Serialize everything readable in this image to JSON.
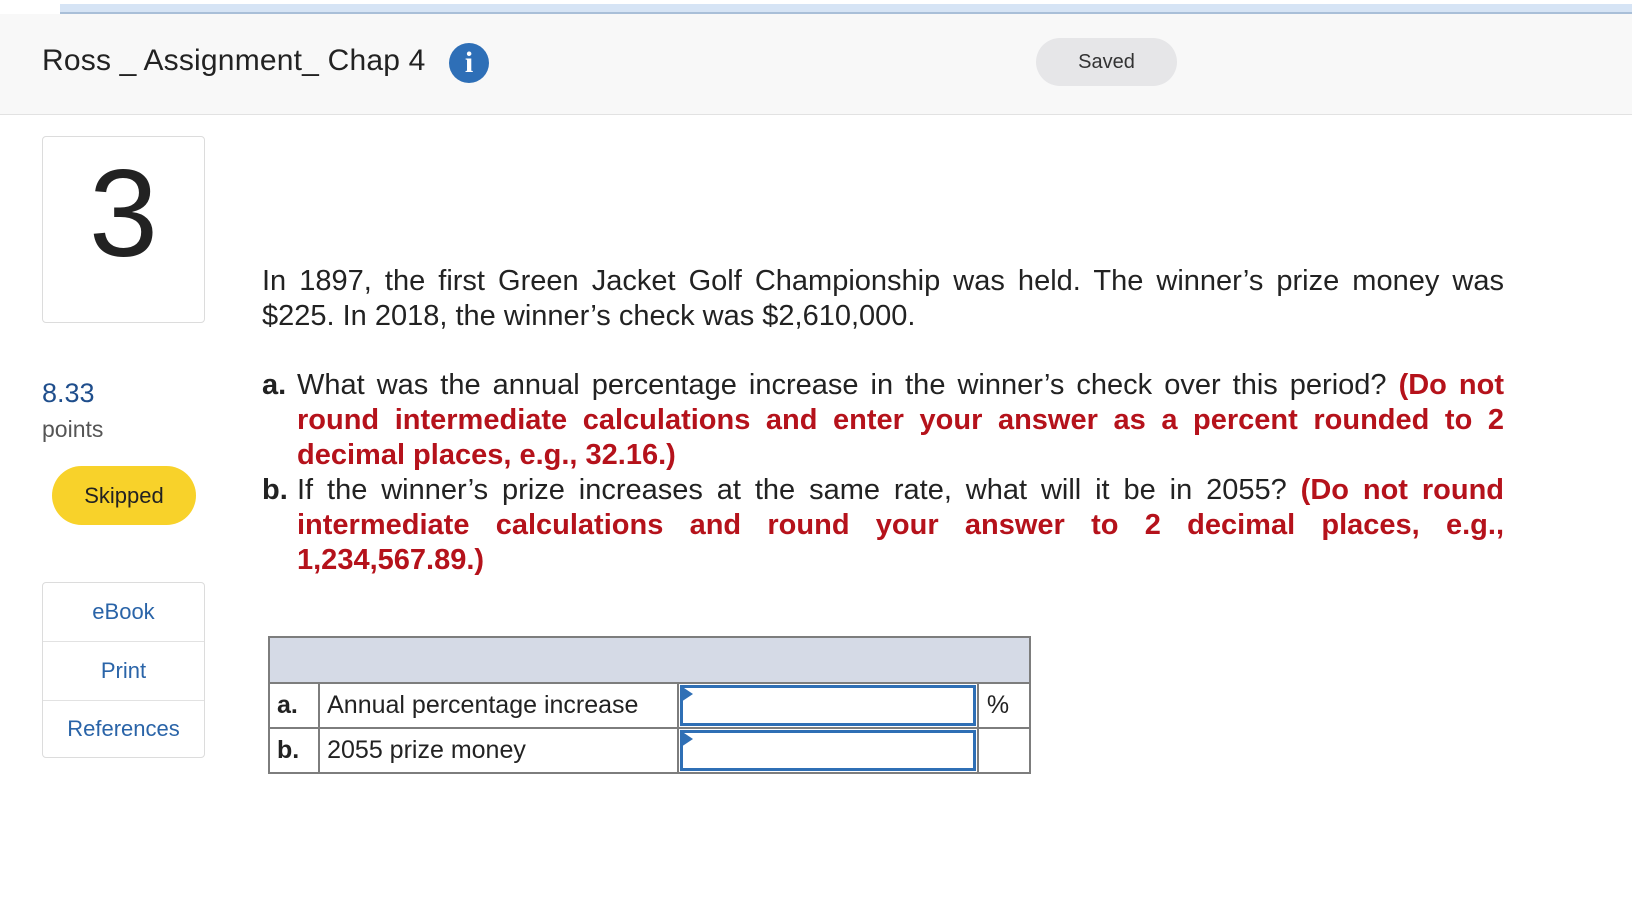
{
  "header": {
    "title": "Ross _ Assignment_ Chap 4",
    "info_icon": "i",
    "saved_label": "Saved"
  },
  "sidebar": {
    "question_number": "3",
    "points_value": "8.33",
    "points_label": "points",
    "status_badge": "Skipped",
    "resources": [
      {
        "label": "eBook"
      },
      {
        "label": "Print"
      },
      {
        "label": "References"
      }
    ]
  },
  "question": {
    "intro": "In 1897, the first Green Jacket Golf Championship was held. The winner’s prize money was $225. In 2018, the winner’s check was $2,610,000.",
    "parts": [
      {
        "letter": "a.",
        "text": "What was the annual percentage increase in the winner’s check over this period?",
        "note": "(Do not round intermediate calculations and enter your answer as a percent rounded to 2 decimal places, e.g., 32.16.)"
      },
      {
        "letter": "b.",
        "text": "If the winner’s prize increases at the same rate, what will it be in 2055?",
        "note": "(Do not round intermediate calculations and round your answer to 2 decimal places, e.g., 1,234,567.89.)"
      }
    ]
  },
  "answer_table": {
    "rows": [
      {
        "letter": "a.",
        "label": "Annual percentage increase",
        "value": "",
        "unit": "%"
      },
      {
        "letter": "b.",
        "label": "2055 prize money",
        "value": "",
        "unit": ""
      }
    ]
  },
  "colors": {
    "accent_blue": "#2f6fb5",
    "note_red": "#b5121b",
    "skipped_yellow": "#f8d22a",
    "table_header": "#d5dae6"
  }
}
